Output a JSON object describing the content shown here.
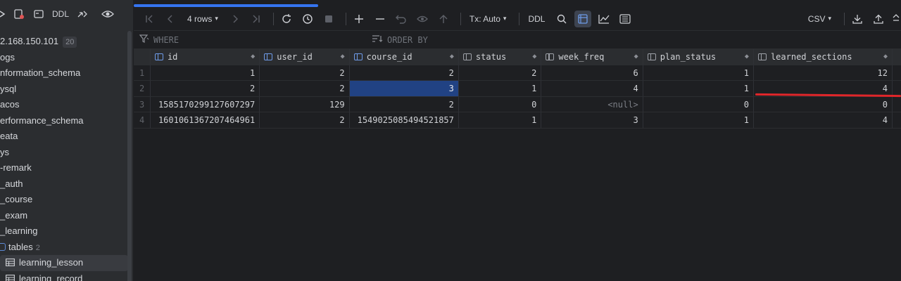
{
  "sidebar": {
    "toolbar": {
      "ddl_label": "DDL"
    },
    "items": [
      {
        "label": "2.168.150.101",
        "badge": "20"
      },
      {
        "label": "ogs"
      },
      {
        "label": "nformation_schema"
      },
      {
        "label": "ysql"
      },
      {
        "label": "acos"
      },
      {
        "label": "erformance_schema"
      },
      {
        "label": "eata"
      },
      {
        "label": "ys"
      },
      {
        "label": "-remark"
      },
      {
        "label": "_auth"
      },
      {
        "label": "_course"
      },
      {
        "label": "_exam"
      },
      {
        "label": "_learning"
      },
      {
        "label": "tables",
        "count": "2"
      },
      {
        "label": "learning_lesson",
        "selected": true
      },
      {
        "label": "learning_record"
      }
    ]
  },
  "toolbar": {
    "rows_label": "4 rows",
    "tx_label": "Tx: Auto",
    "ddl_label": "DDL",
    "export_label": "CSV"
  },
  "filters": {
    "where_placeholder": "WHERE",
    "orderby_placeholder": "ORDER BY"
  },
  "grid": {
    "columns": [
      "id",
      "user_id",
      "course_id",
      "status",
      "week_freq",
      "plan_status",
      "learned_sections"
    ],
    "rows": [
      {
        "num": "1",
        "cells": [
          "1",
          "2",
          "2",
          "2",
          "6",
          "1",
          "12"
        ]
      },
      {
        "num": "2",
        "cells": [
          "2",
          "2",
          "3",
          "1",
          "4",
          "1",
          "4"
        ]
      },
      {
        "num": "3",
        "cells": [
          "1585170299127607297",
          "129",
          "2",
          "0",
          "<null>",
          "0",
          "0"
        ]
      },
      {
        "num": "4",
        "cells": [
          "1601061367207464961",
          "2",
          "1549025085494521857",
          "1",
          "3",
          "1",
          "4"
        ]
      }
    ]
  },
  "colors": {
    "accent": "#3574f0",
    "selection": "#214283",
    "annotation": "#e0262a"
  }
}
